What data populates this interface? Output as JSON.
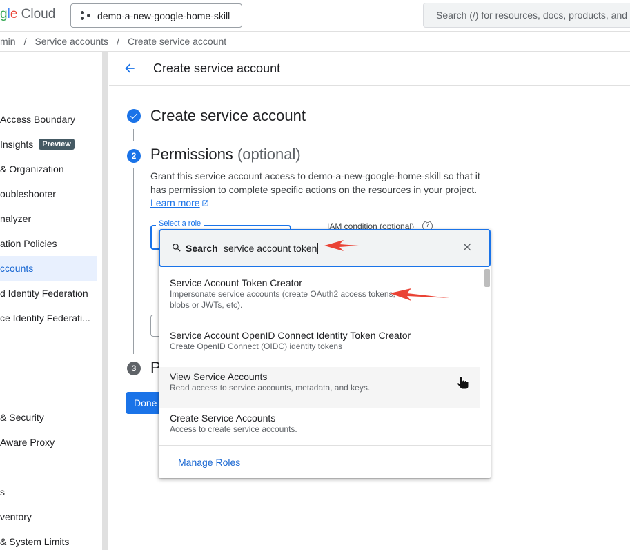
{
  "topbar": {
    "logo_text": "gle Cloud",
    "project_name": "demo-a-new-google-home-skill",
    "search_placeholder": "Search (/) for resources, docs, products, and r"
  },
  "breadcrumb": [
    "min",
    "/",
    "Service accounts",
    "/",
    "Create service account"
  ],
  "sidebar": {
    "items": [
      {
        "label": "Access Boundary"
      },
      {
        "label": "Insights",
        "badge": "Preview"
      },
      {
        "label": "& Organization"
      },
      {
        "label": "oubleshooter"
      },
      {
        "label": "nalyzer"
      },
      {
        "label": "ation Policies"
      },
      {
        "label": "ccounts",
        "active": true
      },
      {
        "label": "d Identity Federation"
      },
      {
        "label": "ce Identity Federati..."
      },
      {
        "label": "& Security"
      },
      {
        "label": "Aware Proxy"
      },
      {
        "label": "s"
      },
      {
        "label": "ventory"
      },
      {
        "label": "& System Limits"
      }
    ]
  },
  "page": {
    "title": "Create service account",
    "step1": {
      "title": "Create service account"
    },
    "step2": {
      "number": "2",
      "title": "Permissions",
      "optional": "(optional)",
      "description": "Grant this service account access to demo-a-new-google-home-skill so that it has permission to complete specific actions on the resources in your project.",
      "learn_more": "Learn more"
    },
    "role_label": "Select a role",
    "iam_condition_label": "IAM condition (optional)",
    "step3": {
      "number": "3",
      "title_stub": "P"
    },
    "done_label": "Done"
  },
  "dropdown": {
    "search_label": "Search",
    "query": "service account token",
    "options": [
      {
        "name": "Service Account Token Creator",
        "desc": "Impersonate service accounts (create OAuth2 access tokens, blobs or JWTs, etc)."
      },
      {
        "name": "Service Account OpenID Connect Identity Token Creator",
        "desc": "Create OpenID Connect (OIDC) identity tokens"
      },
      {
        "name": "View Service Accounts",
        "desc": "Read access to service accounts, metadata, and keys."
      },
      {
        "name": "Create Service Accounts",
        "desc": "Access to create service accounts."
      }
    ],
    "manage_roles": "Manage Roles"
  },
  "colors": {
    "accent": "#1a73e8",
    "annotation": "#ea4335"
  }
}
